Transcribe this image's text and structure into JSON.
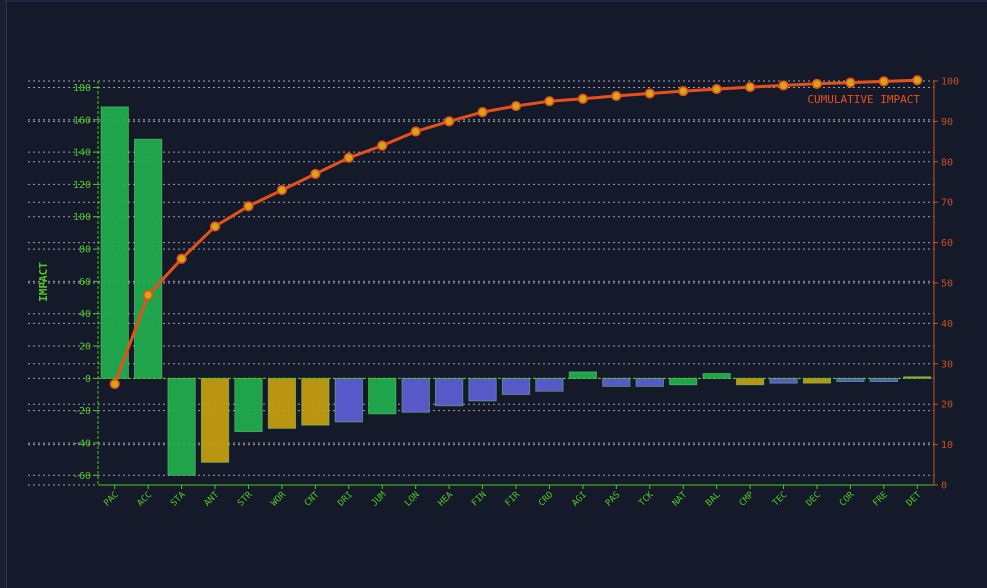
{
  "chart_data": {
    "type": "bar",
    "title": "",
    "xlabel": "",
    "ylabel": "IMPACT",
    "y2label": "CUMULATIVE IMPACT",
    "ylim": [
      -66,
      184
    ],
    "y2lim": [
      0,
      100
    ],
    "yticks": [
      -60,
      -40,
      -20,
      0,
      20,
      40,
      60,
      80,
      100,
      120,
      140,
      160,
      180
    ],
    "y2ticks": [
      0,
      10,
      20,
      30,
      40,
      50,
      60,
      70,
      80,
      90,
      100
    ],
    "grid": true,
    "categories": [
      "PAC",
      "ACC",
      "STA",
      "ANT",
      "STR",
      "WOR",
      "CNT",
      "DRI",
      "JUM",
      "LON",
      "HEA",
      "FIN",
      "FIR",
      "CRO",
      "AGI",
      "PAS",
      "TCK",
      "NAT",
      "BAL",
      "CMP",
      "TEC",
      "DEC",
      "COR",
      "FRE",
      "DET"
    ],
    "values": [
      168,
      148,
      -60,
      -52,
      -33,
      -31,
      -29,
      -27,
      -22,
      -21,
      -17,
      -14,
      -10,
      -8,
      4,
      -5,
      -5,
      -4,
      3,
      -4,
      -3,
      -3,
      -2,
      -2,
      1
    ],
    "bar_colors": [
      "#22b04e",
      "#22b04e",
      "#22b04e",
      "#c9a010",
      "#22b04e",
      "#c9a010",
      "#c9a010",
      "#5d5fd6",
      "#22b04e",
      "#5d5fd6",
      "#5d5fd6",
      "#5d5fd6",
      "#5d5fd6",
      "#5d5fd6",
      "#22b04e",
      "#5d5fd6",
      "#5d5fd6",
      "#22b04e",
      "#22b04e",
      "#c9a010",
      "#5d5fd6",
      "#c9a010",
      "#5d5fd6",
      "#5d5fd6",
      "#c9a010"
    ],
    "cumulative": [
      25,
      47,
      56,
      64,
      69,
      73,
      77,
      81,
      84,
      87.5,
      90,
      92.3,
      93.8,
      95,
      95.6,
      96.3,
      96.9,
      97.5,
      98,
      98.5,
      98.9,
      99.3,
      99.6,
      99.9,
      100.2
    ],
    "line_color": "#e8501a",
    "axis_color_left": "#4fc81e",
    "axis_color_right": "#c8501e"
  }
}
